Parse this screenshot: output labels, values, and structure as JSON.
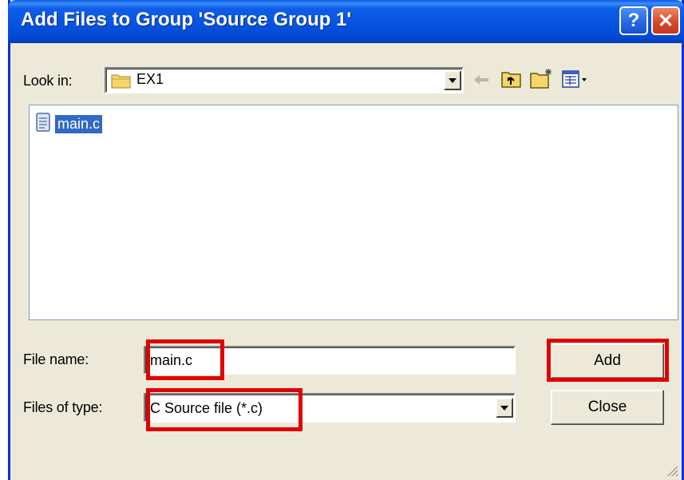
{
  "window": {
    "title": "Add Files to Group 'Source Group 1'",
    "help_label": "?",
    "close_label": "✕"
  },
  "look_in": {
    "label": "Look in:",
    "value": "EX1"
  },
  "toolbar": {
    "icons": [
      "back-arrow-icon",
      "up-folder-icon",
      "new-folder-icon",
      "view-menu-icon"
    ]
  },
  "file_list": {
    "items": [
      {
        "name": "main.c",
        "icon": "c-file-icon",
        "selected": true
      }
    ]
  },
  "file_name": {
    "label": "File name:",
    "value": "main.c"
  },
  "file_type": {
    "label": "Files of type:",
    "value": "C Source file (*.c)"
  },
  "buttons": {
    "add": "Add",
    "close": "Close"
  },
  "colors": {
    "highlight_box": "#e00000",
    "selection": "#316ac5",
    "titlebar": "#0653e0",
    "dialog_bg": "#ece9d8"
  }
}
